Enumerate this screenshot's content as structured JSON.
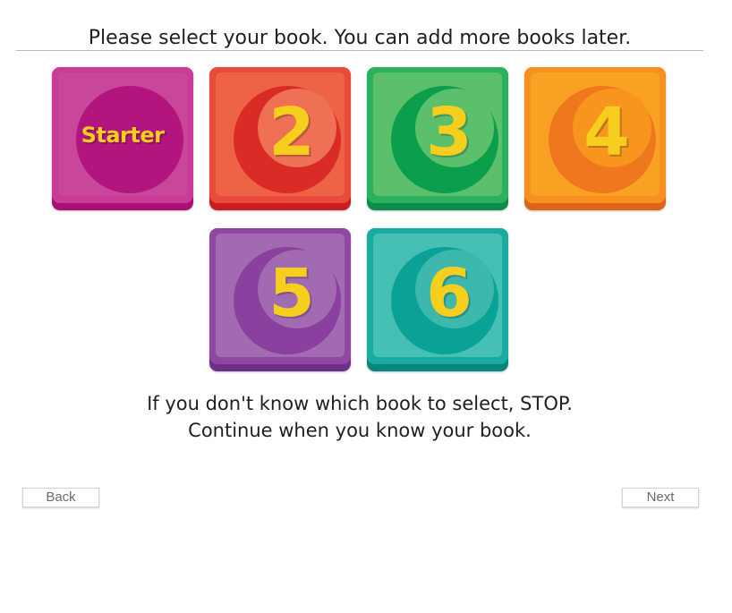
{
  "header": {
    "title": "Please select your book. You can add more books later."
  },
  "books": [
    {
      "label": "Starter",
      "kind": "text",
      "colors": {
        "edge": "#a70f72",
        "face": "#cb3a97",
        "panel": "#c9479a",
        "disc": "#b3157e",
        "inner": "#b3157e"
      }
    },
    {
      "label": "2",
      "kind": "number",
      "colors": {
        "edge": "#c81e1e",
        "face": "#e94a3b",
        "panel": "#ee6246",
        "disc": "#db2b26",
        "inner": "#ee7055"
      }
    },
    {
      "label": "3",
      "kind": "number",
      "colors": {
        "edge": "#0e8d48",
        "face": "#2bb05d",
        "panel": "#5bbf6b",
        "disc": "#0b9e4c",
        "inner": "#5bbf6b"
      }
    },
    {
      "label": "4",
      "kind": "number",
      "colors": {
        "edge": "#dd6416",
        "face": "#f7901e",
        "panel": "#f9a122",
        "disc": "#ef781f",
        "inner": "#f7951f"
      }
    },
    {
      "label": "5",
      "kind": "number",
      "colors": {
        "edge": "#6e2f86",
        "face": "#8e48a3",
        "panel": "#a26bb1",
        "disc": "#8b3f9e",
        "inner": "#a26bb1"
      }
    },
    {
      "label": "6",
      "kind": "number",
      "colors": {
        "edge": "#04877c",
        "face": "#19ab9f",
        "panel": "#46c0b4",
        "disc": "#0aa297",
        "inner": "#3db8ad"
      }
    }
  ],
  "note": {
    "line1": "If you don't know which book to select, STOP.",
    "line2": "Continue when you know your book."
  },
  "nav": {
    "back_label": "Back",
    "next_label": "Next"
  }
}
